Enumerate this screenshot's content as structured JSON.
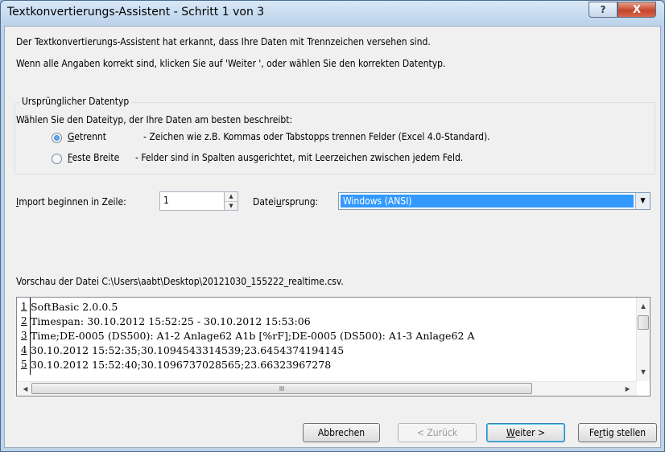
{
  "window": {
    "title": "Textkonvertierungs-Assistent - Schritt 1 von 3",
    "help_glyph": "?",
    "close_glyph": "X"
  },
  "intro": {
    "line1": "Der Textkonvertierungs-Assistent hat erkannt, dass Ihre Daten mit Trennzeichen versehen sind.",
    "line2": "Wenn alle Angaben korrekt sind, klicken Sie auf 'Weiter ', oder wählen Sie den korrekten Datentyp."
  },
  "datatype_group": {
    "label": "Ursprünglicher Datentyp",
    "prompt": "Wählen Sie den Dateityp, der Ihre Daten am besten beschreibt:",
    "options": [
      {
        "key": "G",
        "rest": "etrennt",
        "description": "- Zeichen wie z.B. Kommas oder Tabstopps trennen Felder (Excel 4.0-Standard).",
        "checked": true
      },
      {
        "key": "F",
        "rest": "este Breite",
        "description": "- Felder sind in Spalten ausgerichtet, mit Leerzeichen zwischen jedem Feld.",
        "checked": false
      }
    ]
  },
  "import_row": {
    "label_key": "I",
    "label_rest": "mport beginnen in Zeile:",
    "value": "1",
    "origin_label_pre": "Datei",
    "origin_label_key": "u",
    "origin_label_post": "rsprung:",
    "origin_value": "Windows (ANSI)"
  },
  "preview": {
    "label": "Vorschau der Datei C:\\Users\\aabt\\Desktop\\20121030_155222_realtime.csv.",
    "rows": [
      {
        "num": "1",
        "text": "SoftBasic 2.0.0.5"
      },
      {
        "num": "2",
        "text": "Timespan: 30.10.2012 15:52:25 - 30.10.2012 15:53:06"
      },
      {
        "num": "3",
        "text": "Time;DE-0005 (DS500): A1-2 Anlage62 A1b [%rF];DE-0005 (DS500): A1-3 Anlage62 A"
      },
      {
        "num": "4",
        "text": "30.10.2012 15:52:35;30.1094543314539;23.6454374194145"
      },
      {
        "num": "5",
        "text": "30.10.2012 15:52:40;30.1096737028565;23.66323967278"
      }
    ],
    "hscroll_grip": "III"
  },
  "buttons": {
    "cancel": "Abbrechen",
    "back": "< Zurück",
    "next_key": "W",
    "next_rest": "eiter >",
    "finish_pre": "Fe",
    "finish_key": "r",
    "finish_post": "tig stellen"
  }
}
